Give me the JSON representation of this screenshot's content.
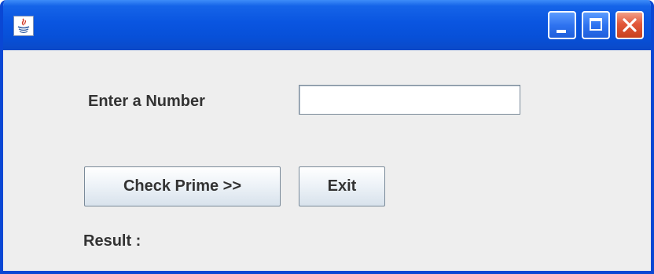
{
  "window": {
    "title": "",
    "icon": "java-icon"
  },
  "form": {
    "number_label": "Enter a Number",
    "number_value": "",
    "result_label": "Result :"
  },
  "buttons": {
    "check_prime": "Check Prime >>",
    "exit": "Exit"
  },
  "colors": {
    "titlebar": "#0a55e0",
    "window_border": "#0a47d4",
    "close_button": "#e2583a",
    "background": "#eeeeee"
  }
}
